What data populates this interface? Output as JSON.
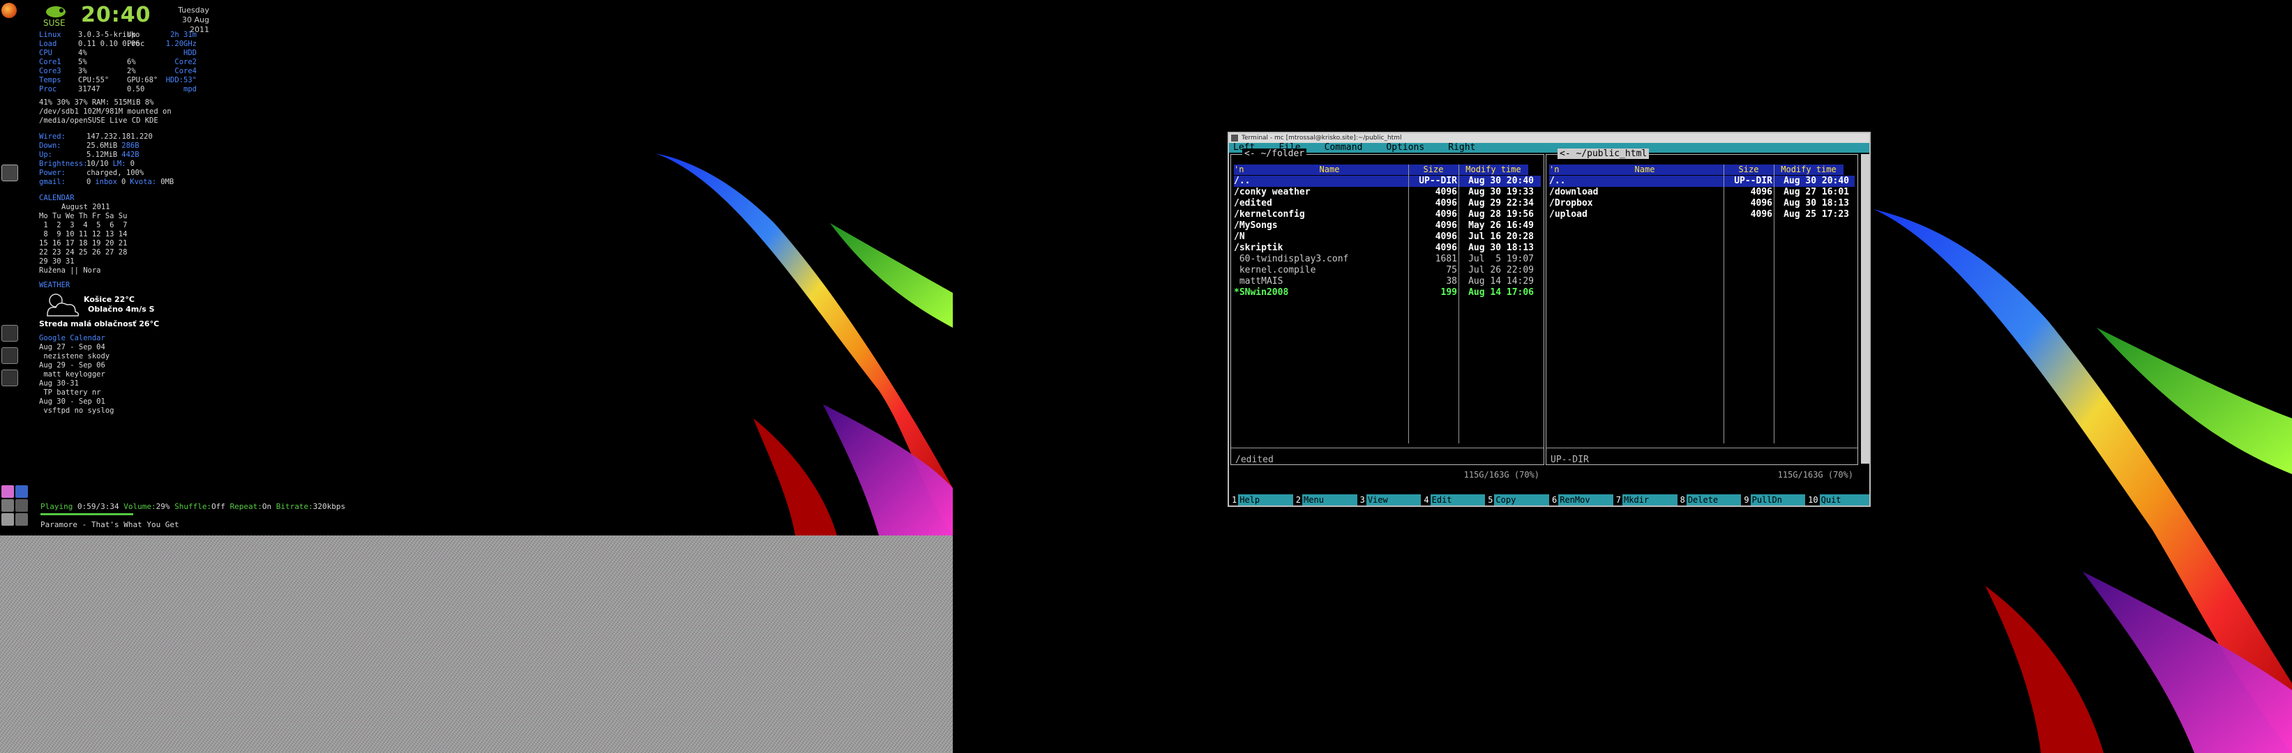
{
  "clock": {
    "time": "20:40",
    "day": "Tuesday",
    "date": "30 Aug 2011",
    "brand": "SUSE"
  },
  "conky": {
    "sys_rows": [
      [
        "Linux",
        "3.0.3-5-krisko",
        "Up",
        "2h 31m"
      ],
      [
        "Load",
        "0.11 0.10 0.06",
        "Proc",
        "1.20GHz"
      ],
      [
        "CPU",
        "4%",
        "",
        "HDD"
      ],
      [
        "Core1",
        "5%",
        "6%",
        "Core2"
      ],
      [
        "Core3",
        "3%",
        "2%",
        "Core4"
      ],
      [
        "Temps",
        "CPU:55°",
        "GPU:68°",
        "HDD:53°"
      ],
      [
        "Proc",
        "31747",
        "0.50",
        "mpd"
      ]
    ],
    "mem_line": "41% 30% 37% RAM: 515MiB 8%",
    "disk_line1": "/dev/sdb1 102M/981M mounted on",
    "disk_line2": "/media/openSUSE Live CD KDE",
    "net": [
      [
        "Wired:",
        "147.232.181.220"
      ],
      [
        "Down:",
        "25.6MiB",
        "286B"
      ],
      [
        "Up:",
        "5.12MiB",
        "442B"
      ],
      [
        "Brightness:",
        "10/10",
        "LM:",
        "0"
      ],
      [
        "Power:",
        "charged, 100%"
      ],
      [
        "gmail:",
        "0",
        "inbox",
        "0",
        "Kvota:",
        "0MB"
      ]
    ],
    "calendar_title": "CALENDAR",
    "calendar_month": "August 2011",
    "calendar_rows": [
      "Mo Tu We Th Fr Sa Su",
      " 1  2  3  4  5  6  7",
      " 8  9 10 11 12 13 14",
      "15 16 17 18 19 20 21",
      "22 23 24 25 26 27 28",
      "29 30 31"
    ],
    "nameday": "Ružena || Nora",
    "weather_title": "WEATHER",
    "weather_city": "Košice 22°C",
    "weather_cond": "Oblačno 4m/s S",
    "weather_tomorrow": "Streda malá oblačnosť 26°C",
    "gcal_title": "Google Calendar",
    "gcal": [
      "Aug 27 - Sep 04",
      " nezistene skody",
      "Aug 29 - Sep 06",
      " matt keylogger",
      "Aug 30-31",
      " TP battery nr",
      "Aug 30 - Sep 01",
      " vsftpd no syslog"
    ]
  },
  "music": {
    "playing_label": "Playing",
    "time": "0:59/3:34",
    "volume_label": "Volume:",
    "volume": "29%",
    "shuffle_label": "Shuffle:",
    "shuffle": "Off",
    "repeat_label": "Repeat:",
    "repeat": "On",
    "bitrate_label": "Bitrate:",
    "bitrate": "320kbps",
    "song": "Paramore - That's What You Get",
    "progress": 0.28
  },
  "terminal": {
    "title": "Terminal - mc [mtrossal@krisko.site]:~/public_html",
    "menu": [
      "Left",
      "File",
      "Command",
      "Options",
      "Right"
    ],
    "left_panel": {
      "path": "~/folder",
      "headers": [
        "'n",
        "Name",
        "Size",
        "Modify time"
      ],
      "rows": [
        {
          "name": "/..",
          "size": "UP--DIR",
          "date": "Aug 30 20:40",
          "type": "sel"
        },
        {
          "name": "/conky weather",
          "size": "4096",
          "date": "Aug 30 19:33",
          "type": "dir"
        },
        {
          "name": "/edited",
          "size": "4096",
          "date": "Aug 29 22:34",
          "type": "dir"
        },
        {
          "name": "/kernelconfig",
          "size": "4096",
          "date": "Aug 28 19:56",
          "type": "dir"
        },
        {
          "name": "/MySongs",
          "size": "4096",
          "date": "May 26 16:49",
          "type": "dir"
        },
        {
          "name": "/N",
          "size": "4096",
          "date": "Jul 16 20:28",
          "type": "dir"
        },
        {
          "name": "/skriptik",
          "size": "4096",
          "date": "Aug 30 18:13",
          "type": "dir"
        },
        {
          "name": " 60-twindisplay3.conf",
          "size": "1681",
          "date": "Jul  5 19:07",
          "type": "file"
        },
        {
          "name": " kernel.compile",
          "size": "75",
          "date": "Jul 26 22:09",
          "type": "file"
        },
        {
          "name": " mattMAIS",
          "size": "38",
          "date": "Aug 14 14:29",
          "type": "file"
        },
        {
          "name": "*SNwin2008",
          "size": "199",
          "date": "Aug 14 17:06",
          "type": "exe"
        }
      ],
      "mini_info": "/edited",
      "free": "115G/163G (70%)"
    },
    "right_panel": {
      "path": "~/public_html",
      "headers": [
        "'n",
        "Name",
        "Size",
        "Modify time"
      ],
      "rows": [
        {
          "name": "/..",
          "size": "UP--DIR",
          "date": "Aug 30 20:40",
          "type": "sel"
        },
        {
          "name": "/download",
          "size": "4096",
          "date": "Aug 27 16:01",
          "type": "dir"
        },
        {
          "name": "/Dropbox",
          "size": "4096",
          "date": "Aug 30 18:13",
          "type": "dir"
        },
        {
          "name": "/upload",
          "size": "4096",
          "date": "Aug 25 17:23",
          "type": "dir"
        }
      ],
      "mini_info": "UP--DIR",
      "free": "115G/163G (70%)"
    },
    "keys": [
      {
        "n": "1",
        "l": "Help"
      },
      {
        "n": "2",
        "l": "Menu"
      },
      {
        "n": "3",
        "l": "View"
      },
      {
        "n": "4",
        "l": "Edit"
      },
      {
        "n": "5",
        "l": "Copy"
      },
      {
        "n": "6",
        "l": "RenMov"
      },
      {
        "n": "7",
        "l": "Mkdir"
      },
      {
        "n": "8",
        "l": "Delete"
      },
      {
        "n": "9",
        "l": "PullDn"
      },
      {
        "n": "10",
        "l": "Quit"
      }
    ]
  },
  "colors": {
    "accent_green": "#9bd648",
    "conky_blue": "#4a86ff",
    "mc_cyan": "#2a9aa7",
    "mc_select": "#1a28a8"
  }
}
